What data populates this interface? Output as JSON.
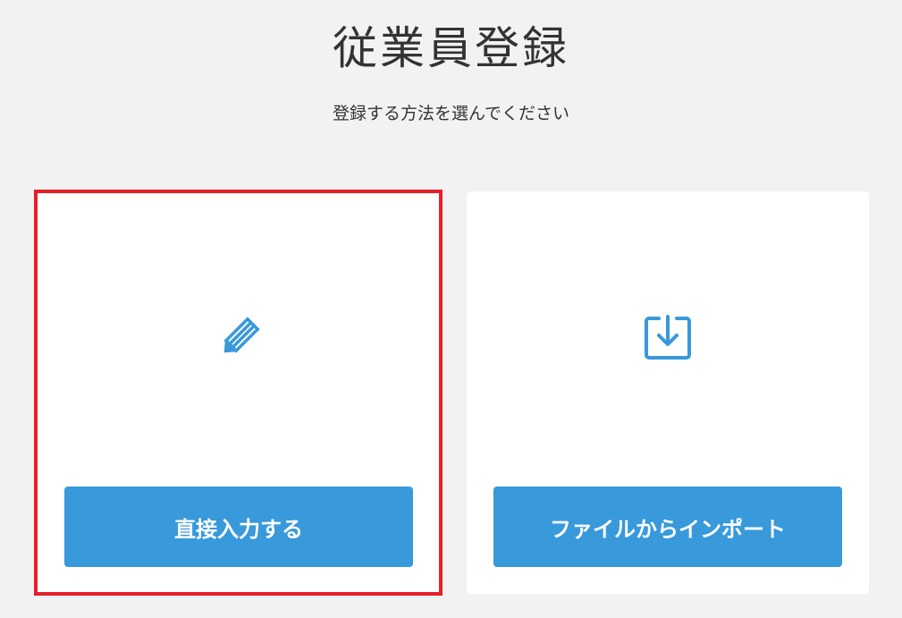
{
  "header": {
    "title": "従業員登録",
    "subtitle": "登録する方法を選んでください"
  },
  "options": [
    {
      "id": "direct",
      "icon": "pencil-icon",
      "button_label": "直接入力する",
      "selected": true
    },
    {
      "id": "import",
      "icon": "import-icon",
      "button_label": "ファイルからインポート",
      "selected": false
    }
  ],
  "colors": {
    "accent": "#3899db",
    "highlight": "#e5202a",
    "background": "#f2f2f2",
    "card": "#ffffff"
  }
}
